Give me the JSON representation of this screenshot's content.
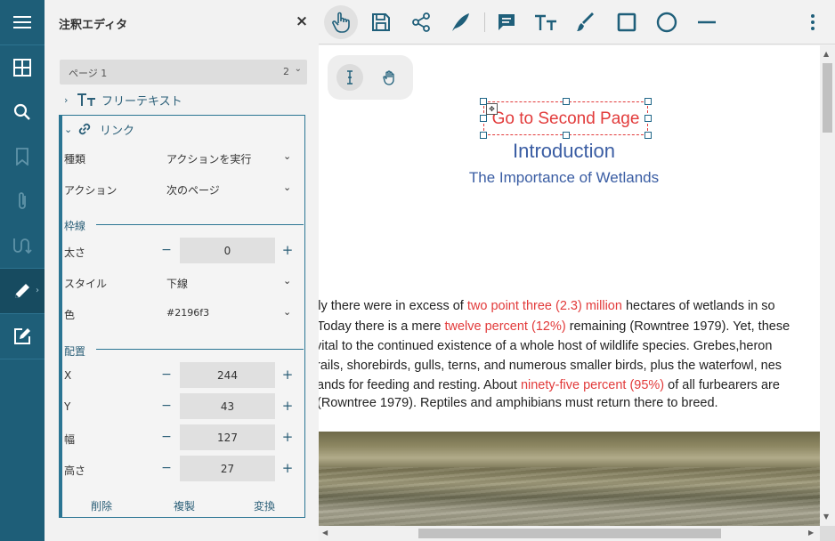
{
  "panel": {
    "title": "注釈エディタ",
    "page_label": "ページ 1",
    "page_count": "2",
    "tree": {
      "freetext_label": "フリーテキスト",
      "link_label": "リンク"
    },
    "props": {
      "type_label": "種類",
      "type_value": "アクションを実行",
      "action_label": "アクション",
      "action_value": "次のページ",
      "border_group": "枠線",
      "thickness_label": "太さ",
      "thickness_value": "0",
      "style_label": "スタイル",
      "style_value": "下線",
      "color_label": "色",
      "color_value": "#2196f3",
      "position_group": "配置",
      "x_label": "X",
      "x_value": "244",
      "y_label": "Y",
      "y_value": "43",
      "width_label": "幅",
      "width_value": "127",
      "height_label": "高さ",
      "height_value": "27"
    },
    "actions": {
      "delete": "削除",
      "duplicate": "複製",
      "convert": "変換"
    }
  },
  "document": {
    "annotation_text": "Go to Second Page",
    "title": "Introduction",
    "subtitle": "The Importance of Wetlands",
    "lines": [
      {
        "a": "lly there were in excess of ",
        "b": "two point three (2.3) million",
        "c": " hectares of wetlands in so"
      },
      {
        "a": "Today there is a mere ",
        "b": "twelve percent (12%)",
        "c": " remaining (Rowntree 1979). Yet, these"
      },
      {
        "a": " vital to the continued existence of a whole host of wildlife species. Grebes,heron",
        "b": "",
        "c": ""
      },
      {
        "a": "rails, shorebirds, gulls, terns, and numerous smaller birds, plus the waterfowl, nes",
        "b": "",
        "c": ""
      },
      {
        "a": "ands for feeding and resting. About ",
        "b": "ninety-five percent (95%)",
        "c": " of all furbearers are"
      },
      {
        "a": "(Rowntree 1979). Reptiles and amphibians must return there to breed.",
        "b": "",
        "c": ""
      }
    ]
  },
  "colors": {
    "rail": "#1e5e78",
    "accent": "#2b7593",
    "annotation": "#e23b3b",
    "heading": "#3a5da3"
  }
}
